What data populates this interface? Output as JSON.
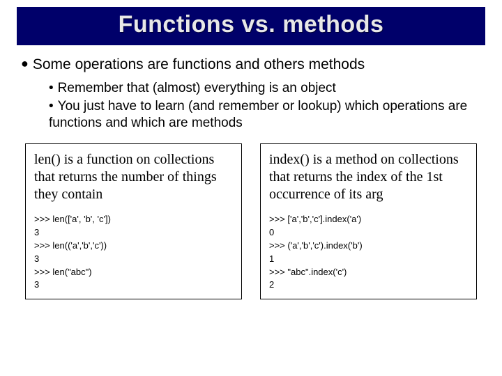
{
  "title": "Functions vs. methods",
  "main_bullet": "Some operations are functions and others methods",
  "sub_bullets": [
    "Remember that (almost) everything is an object",
    "You just have to learn (and remember or lookup) which operations are functions and which are methods"
  ],
  "columns": {
    "left": {
      "heading": "len() is a function on collections that returns the number of things they contain",
      "code": ">>> len(['a', 'b', 'c'])\n3\n>>> len(('a','b','c'))\n3\n>>> len(\"abc\")\n3"
    },
    "right": {
      "heading": "index() is a method on collections that returns the index of the 1st occurrence of its arg",
      "code": ">>> ['a','b','c'].index('a')\n0\n>>> ('a','b','c').index('b')\n1\n>>> \"abc\".index('c')\n2"
    }
  }
}
